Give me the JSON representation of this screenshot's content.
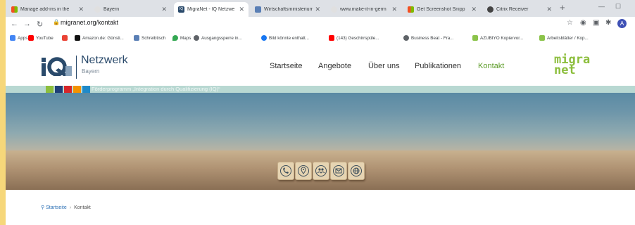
{
  "browser": {
    "tabs": [
      {
        "label": "Manage add-ins in the",
        "icon": "windows-icon",
        "active": false
      },
      {
        "label": "Bayern",
        "icon": "bayern-icon",
        "active": false
      },
      {
        "label": "MigraNet - IQ Netzwe",
        "icon": "iq-icon",
        "active": true
      },
      {
        "label": "Wirtschaftsministerium",
        "icon": "edit-icon",
        "active": false
      },
      {
        "label": "www.make-it-in-germ",
        "icon": "bayern-icon",
        "active": false
      },
      {
        "label": "Get Screenshot Snipp",
        "icon": "windows-icon",
        "active": false
      },
      {
        "label": "Citrix Receiver",
        "icon": "citrix-icon",
        "active": false
      }
    ],
    "new_tab": "+",
    "url": "migranet.org/kontakt",
    "avatar_letter": "A",
    "bookmarks": [
      {
        "label": "Apps",
        "icon": "apps-grid-icon",
        "color": "#4285f4"
      },
      {
        "label": "YouTube",
        "icon": "youtube-icon",
        "color": "#ff0000"
      },
      {
        "label": "",
        "icon": "bookmark-b-icon",
        "color": "#ea4335"
      },
      {
        "label": "Amazon.de: Günsti...",
        "icon": "amazon-icon",
        "color": "#111111"
      },
      {
        "label": "Schreibtisch",
        "icon": "schreibtisch-icon",
        "color": "#5a7fb5"
      },
      {
        "label": "Maps",
        "icon": "maps-pin-icon",
        "color": "#34a853"
      },
      {
        "label": "Ausgangssperre in...",
        "icon": "globe-icon",
        "color": "#5f6368"
      },
      {
        "label": "Bild könnte enthalt...",
        "icon": "facebook-icon",
        "color": "#1877f2"
      },
      {
        "label": "(143) Geschirrspüle...",
        "icon": "youtube-icon",
        "color": "#ff0000"
      },
      {
        "label": "Business Beat - Fra...",
        "icon": "globe-icon",
        "color": "#5f6368"
      },
      {
        "label": "AZUBIYO Kopiervor...",
        "icon": "azubiyo-icon",
        "color": "#8bc34a"
      },
      {
        "label": "Arbeitsblätter / Kop...",
        "icon": "azubiyo-icon",
        "color": "#8bc34a"
      }
    ]
  },
  "site": {
    "logo": {
      "mark": "IQ",
      "title": "Netzwerk",
      "subtitle": "Bayern"
    },
    "nav": [
      {
        "label": "Startseite",
        "active": false
      },
      {
        "label": "Angebote",
        "active": false
      },
      {
        "label": "Über uns",
        "active": false
      },
      {
        "label": "Publikationen",
        "active": false
      },
      {
        "label": "Kontakt",
        "active": true
      }
    ],
    "brand": {
      "line1": "migra",
      "line2": "net",
      "color": "#8cbe3c"
    },
    "program_text": "Förderprogramm „Integration durch Qualifizierung (IQ)“",
    "program_colors": [
      "#8cbe3c",
      "#1f3e78",
      "#d6262b",
      "#f39200",
      "#1f8ac9"
    ],
    "hero_cubes": [
      "phone-icon",
      "location-pin-icon",
      "people-icon",
      "mail-icon",
      "globe-icon"
    ],
    "breadcrumb": {
      "home": "Startseite",
      "separator": "›",
      "current": "Kontakt"
    }
  }
}
